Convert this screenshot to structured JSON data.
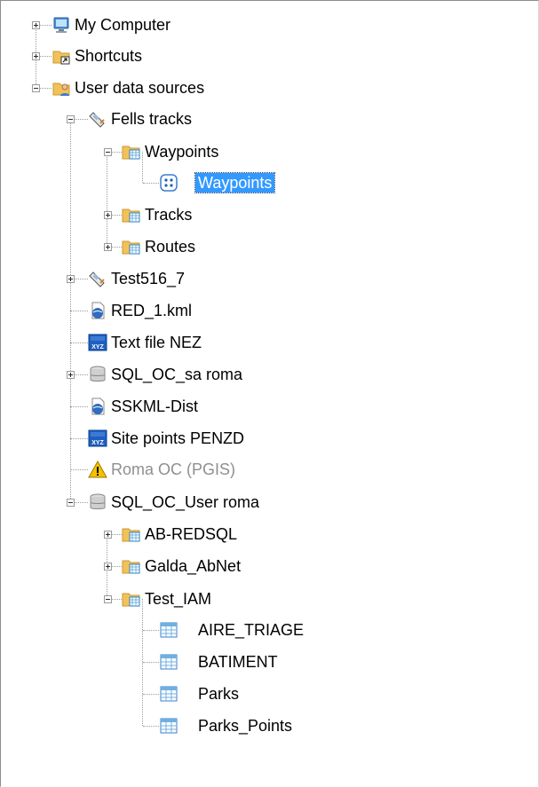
{
  "tree": {
    "items": [
      {
        "label": "My Computer",
        "icon": "computer-icon",
        "expander": "plus"
      },
      {
        "label": "Shortcuts",
        "icon": "shortcut-folder-icon",
        "expander": "plus"
      },
      {
        "label": "User data sources",
        "icon": "user-folder-icon",
        "expander": "minus"
      },
      {
        "label": "Fells tracks",
        "icon": "gps-device-icon",
        "expander": "minus"
      },
      {
        "label": "Waypoints",
        "icon": "table-folder-icon",
        "expander": "minus"
      },
      {
        "label": "Waypoints",
        "icon": "point-layer-icon",
        "expander": "none",
        "selected": true
      },
      {
        "label": "Tracks",
        "icon": "table-folder-icon",
        "expander": "plus"
      },
      {
        "label": "Routes",
        "icon": "table-folder-icon",
        "expander": "plus"
      },
      {
        "label": "Test516_7",
        "icon": "gps-device-icon",
        "expander": "plus"
      },
      {
        "label": "RED_1.kml",
        "icon": "kml-file-icon",
        "expander": "none"
      },
      {
        "label": "Text file NEZ",
        "icon": "xyz-file-icon",
        "expander": "none"
      },
      {
        "label": "SQL_OC_sa roma",
        "icon": "database-icon",
        "expander": "plus"
      },
      {
        "label": "SSKML-Dist",
        "icon": "kml-file-icon",
        "expander": "none"
      },
      {
        "label": "Site points PENZD",
        "icon": "xyz-file-icon",
        "expander": "none"
      },
      {
        "label": "Roma OC (PGIS)",
        "icon": "warning-icon",
        "expander": "none",
        "disabled": true
      },
      {
        "label": "SQL_OC_User roma",
        "icon": "database-icon",
        "expander": "minus"
      },
      {
        "label": "AB-REDSQL",
        "icon": "table-folder-icon",
        "expander": "plus"
      },
      {
        "label": "Galda_AbNet",
        "icon": "table-folder-icon",
        "expander": "plus"
      },
      {
        "label": "Test_IAM",
        "icon": "table-folder-icon",
        "expander": "minus"
      },
      {
        "label": "AIRE_TRIAGE",
        "icon": "table-icon",
        "expander": "none"
      },
      {
        "label": "BATIMENT",
        "icon": "table-icon",
        "expander": "none"
      },
      {
        "label": "Parks",
        "icon": "table-icon",
        "expander": "none"
      },
      {
        "label": "Parks_Points",
        "icon": "table-icon",
        "expander": "none"
      }
    ]
  },
  "colors": {
    "selection": "#3399ff",
    "folder": "#f2c25a",
    "link": "#2f6dbf",
    "warning": "#f2c200"
  }
}
